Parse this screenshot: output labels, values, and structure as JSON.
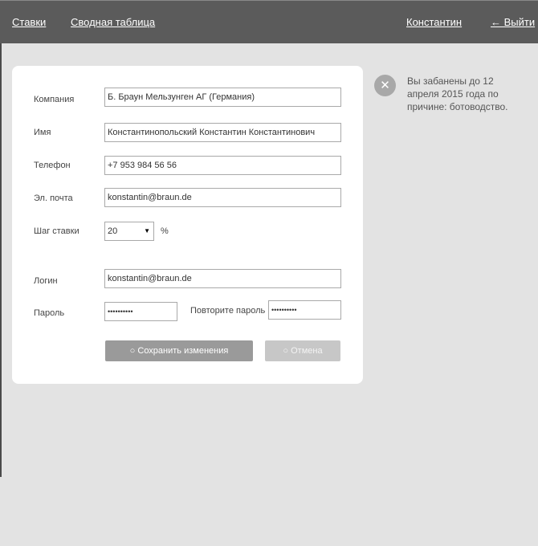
{
  "nav": {
    "bids": "Ставки",
    "summary_table": "Сводная таблица",
    "user": "Константин",
    "logout": "← Выйти"
  },
  "form": {
    "company_label": "Компания",
    "company_value": "Б. Браун Мельзунген АГ (Германия)",
    "name_label": "Имя",
    "name_value": "Константинопольский Константин Константинович",
    "phone_label": "Телефон",
    "phone_value": "+7 953 984 56 56",
    "email_label": "Эл. почта",
    "email_value": "konstantin@braun.de",
    "bid_step_label": "Шаг ставки",
    "bid_step_value": "20",
    "bid_step_unit": "%",
    "login_label": "Логин",
    "login_value": "konstantin@braun.de",
    "password_label": "Пароль",
    "password_value": "••••••••••",
    "repeat_password_label": "Повторите пароль",
    "repeat_password_value": "••••••••••",
    "save_button": "○ Сохранить изменения",
    "cancel_button": "○ Отмена"
  },
  "notice": {
    "icon": "close-icon",
    "icon_glyph": "✕",
    "text": "Вы забанены до 12 апреля 2015 года по причине: ботоводство."
  },
  "colors": {
    "header_bg": "#5b5b5b",
    "page_bg": "#e3e3e3",
    "card_bg": "#ffffff",
    "save_button_bg": "#9a9a9a",
    "cancel_button_bg": "#c7c7c7"
  }
}
